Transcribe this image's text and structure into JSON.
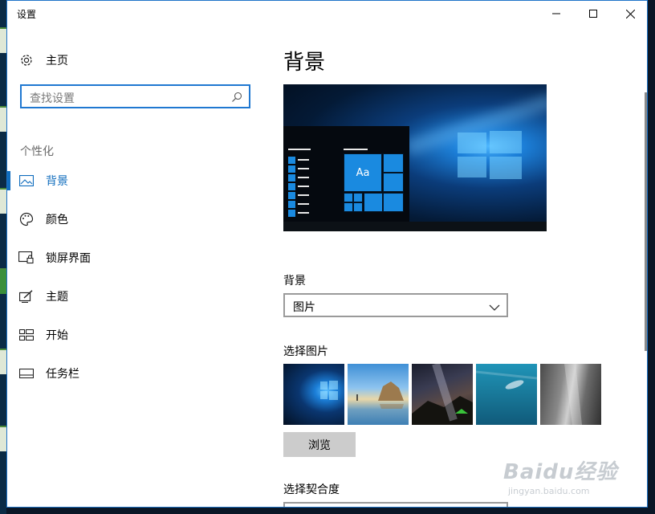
{
  "window": {
    "title": "设置",
    "controls": [
      "minimize-icon",
      "maximize-icon",
      "close-icon"
    ]
  },
  "sidebar": {
    "home_label": "主页",
    "search_placeholder": "查找设置",
    "section_label": "个性化",
    "items": [
      {
        "label": "背景",
        "icon": "picture-icon",
        "active": true
      },
      {
        "label": "颜色",
        "icon": "palette-icon",
        "active": false
      },
      {
        "label": "锁屏界面",
        "icon": "lock-screen-icon",
        "active": false
      },
      {
        "label": "主题",
        "icon": "theme-icon",
        "active": false
      },
      {
        "label": "开始",
        "icon": "start-grid-icon",
        "active": false
      },
      {
        "label": "任务栏",
        "icon": "taskbar-icon",
        "active": false
      }
    ]
  },
  "main": {
    "title": "背景",
    "preview_tile_text": "Aa",
    "background_label": "背景",
    "background_value": "图片",
    "choose_picture_label": "选择图片",
    "browse_label": "浏览",
    "choose_fit_label": "选择契合度"
  },
  "watermark": {
    "logo_text": "Baidu经验",
    "url_text": "jingyan.baidu.com"
  },
  "colors": {
    "accent": "#0f6cbd",
    "window_border": "#1e74c8",
    "button_gray": "#cccccc"
  }
}
